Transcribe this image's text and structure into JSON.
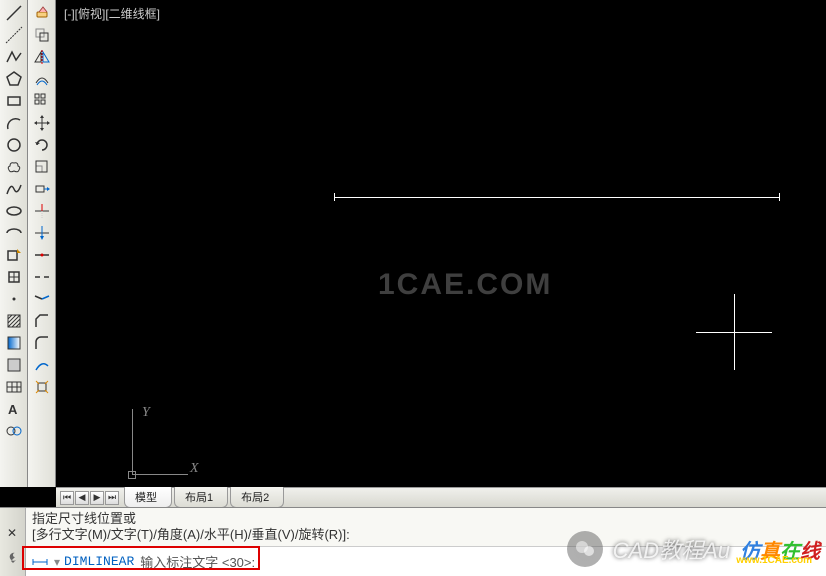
{
  "viewport": {
    "label": "[-][俯视][二维线框]"
  },
  "watermark": "1CAE.COM",
  "ucs": {
    "x_label": "X",
    "y_label": "Y"
  },
  "toolbars": {
    "draw": [
      {
        "name": "line-icon"
      },
      {
        "name": "construction-line-icon"
      },
      {
        "name": "polyline-icon"
      },
      {
        "name": "polygon-icon"
      },
      {
        "name": "rectangle-icon"
      },
      {
        "name": "arc-icon"
      },
      {
        "name": "circle-icon"
      },
      {
        "name": "revision-cloud-icon"
      },
      {
        "name": "spline-icon"
      },
      {
        "name": "ellipse-icon"
      },
      {
        "name": "ellipse-arc-icon"
      },
      {
        "name": "insert-block-icon"
      },
      {
        "name": "make-block-icon"
      },
      {
        "name": "point-icon"
      },
      {
        "name": "hatch-icon"
      },
      {
        "name": "gradient-icon"
      },
      {
        "name": "region-icon"
      },
      {
        "name": "table-icon"
      },
      {
        "name": "mtext-icon"
      },
      {
        "name": "add-selected-icon"
      }
    ],
    "modify": [
      {
        "name": "erase-icon"
      },
      {
        "name": "copy-icon"
      },
      {
        "name": "mirror-icon"
      },
      {
        "name": "offset-icon"
      },
      {
        "name": "array-icon"
      },
      {
        "name": "move-icon"
      },
      {
        "name": "rotate-icon"
      },
      {
        "name": "scale-icon"
      },
      {
        "name": "stretch-icon"
      },
      {
        "name": "trim-icon"
      },
      {
        "name": "extend-icon"
      },
      {
        "name": "break-at-point-icon"
      },
      {
        "name": "break-icon"
      },
      {
        "name": "join-icon"
      },
      {
        "name": "chamfer-icon"
      },
      {
        "name": "fillet-icon"
      },
      {
        "name": "blend-icon"
      },
      {
        "name": "explode-icon"
      }
    ]
  },
  "tabs": {
    "scroll": {
      "first": "⏮",
      "prev": "◀",
      "next": "▶",
      "last": "⏭"
    },
    "items": [
      {
        "label": "模型",
        "active": true
      },
      {
        "label": "布局1",
        "active": false
      },
      {
        "label": "布局2",
        "active": false
      }
    ]
  },
  "command": {
    "close_symbol": "✕",
    "history_line1": "指定尺寸线位置或",
    "history_line2": "[多行文字(M)/文字(T)/角度(A)/水平(H)/垂直(V)/旋转(R)]:",
    "current_cmd": "DIMLINEAR",
    "prompt": "输入标注文字 <30>:"
  },
  "overlays": {
    "cad_text": "CAD教程Au",
    "brand_1cae": "仿真在线",
    "url": "www.1CAE.com"
  }
}
